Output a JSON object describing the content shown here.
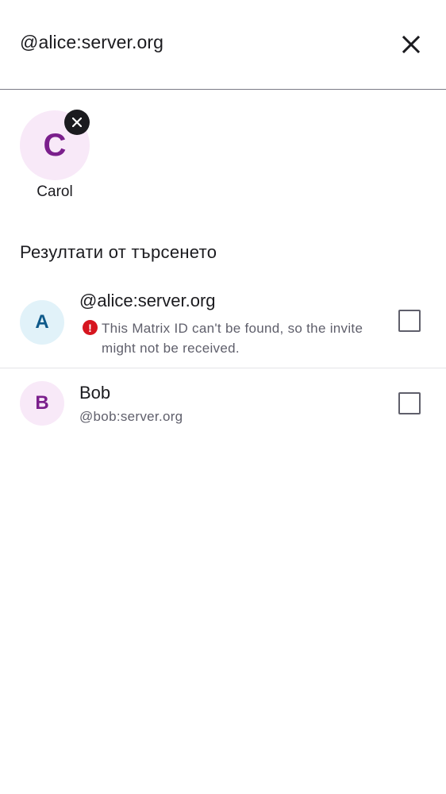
{
  "search": {
    "query": "@alice:server.org"
  },
  "icons": {
    "clear": "close-icon",
    "remove": "close-icon",
    "warning": "error-icon"
  },
  "selected": {
    "users": [
      {
        "initial": "C",
        "name": "Carol"
      }
    ]
  },
  "results": {
    "title": "Резултати от търсенето",
    "items": [
      {
        "initial": "A",
        "title": "@alice:server.org",
        "warning": "This Matrix ID can't be found, so the invite might not be received.",
        "checked": false
      },
      {
        "initial": "B",
        "title": "Bob",
        "subtitle": "@bob:server.org",
        "checked": false
      }
    ]
  },
  "colors": {
    "avatar_a_bg": "#e1f2f9",
    "avatar_a_fg": "#0f5a8a",
    "avatar_b_bg": "#f8e9f8",
    "avatar_b_fg": "#7b1f8c",
    "warning": "#d6151f"
  }
}
